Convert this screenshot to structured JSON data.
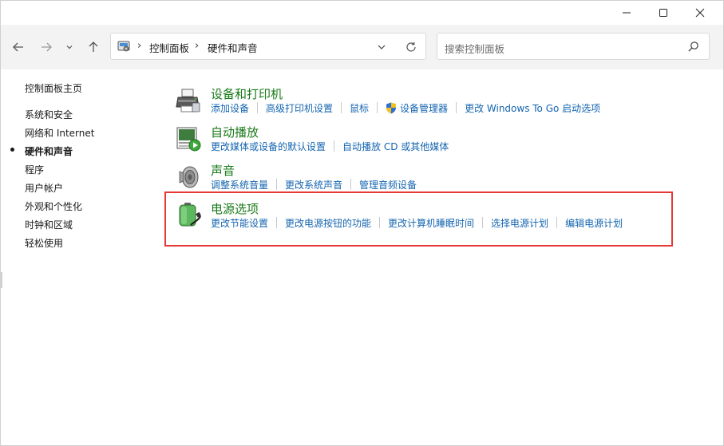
{
  "window": {
    "controls": {
      "minimize": "minimize-icon",
      "maximize": "maximize-icon",
      "close": "close-icon"
    }
  },
  "navigation": {
    "back": "arrow-left-icon",
    "forward": "arrow-right-icon",
    "recent": "chevron-down-icon",
    "up": "arrow-up-icon"
  },
  "address": {
    "icon": "control-panel-icon",
    "separator": "›",
    "crumbs": [
      "控制面板",
      "硬件和声音"
    ],
    "dropdown": "chevron-down-icon",
    "refresh": "refresh-icon"
  },
  "search": {
    "placeholder": "搜索控制面板",
    "icon": "search-icon"
  },
  "sidebar": {
    "items": [
      {
        "label": "控制面板主页"
      },
      {
        "label": "系统和安全"
      },
      {
        "label": "网络和 Internet"
      },
      {
        "label": "硬件和声音",
        "current": true
      },
      {
        "label": "程序"
      },
      {
        "label": "用户帐户"
      },
      {
        "label": "外观和个性化"
      },
      {
        "label": "时钟和区域"
      },
      {
        "label": "轻松使用"
      }
    ]
  },
  "categories": [
    {
      "title": "设备和打印机",
      "icon": "printer-icon",
      "links": [
        "添加设备",
        "高级打印机设置",
        "鼠标",
        "设备管理器",
        "更改 Windows To Go 启动选项"
      ]
    },
    {
      "title": "自动播放",
      "icon": "autoplay-icon",
      "links": [
        "更改媒体或设备的默认设置",
        "自动播放 CD 或其他媒体"
      ]
    },
    {
      "title": "声音",
      "icon": "speaker-icon",
      "links": [
        "调整系统音量",
        "更改系统声音",
        "管理音频设备"
      ]
    },
    {
      "title": "电源选项",
      "icon": "battery-icon",
      "links": [
        "更改节能设置",
        "更改电源按钮的功能",
        "更改计算机睡眠时间",
        "选择电源计划",
        "编辑电源计划"
      ]
    }
  ],
  "colors": {
    "category_title": "#1a7a1a",
    "link": "#1565b0",
    "highlight": "#e53935",
    "navbar_bg": "#f3f3f3"
  }
}
